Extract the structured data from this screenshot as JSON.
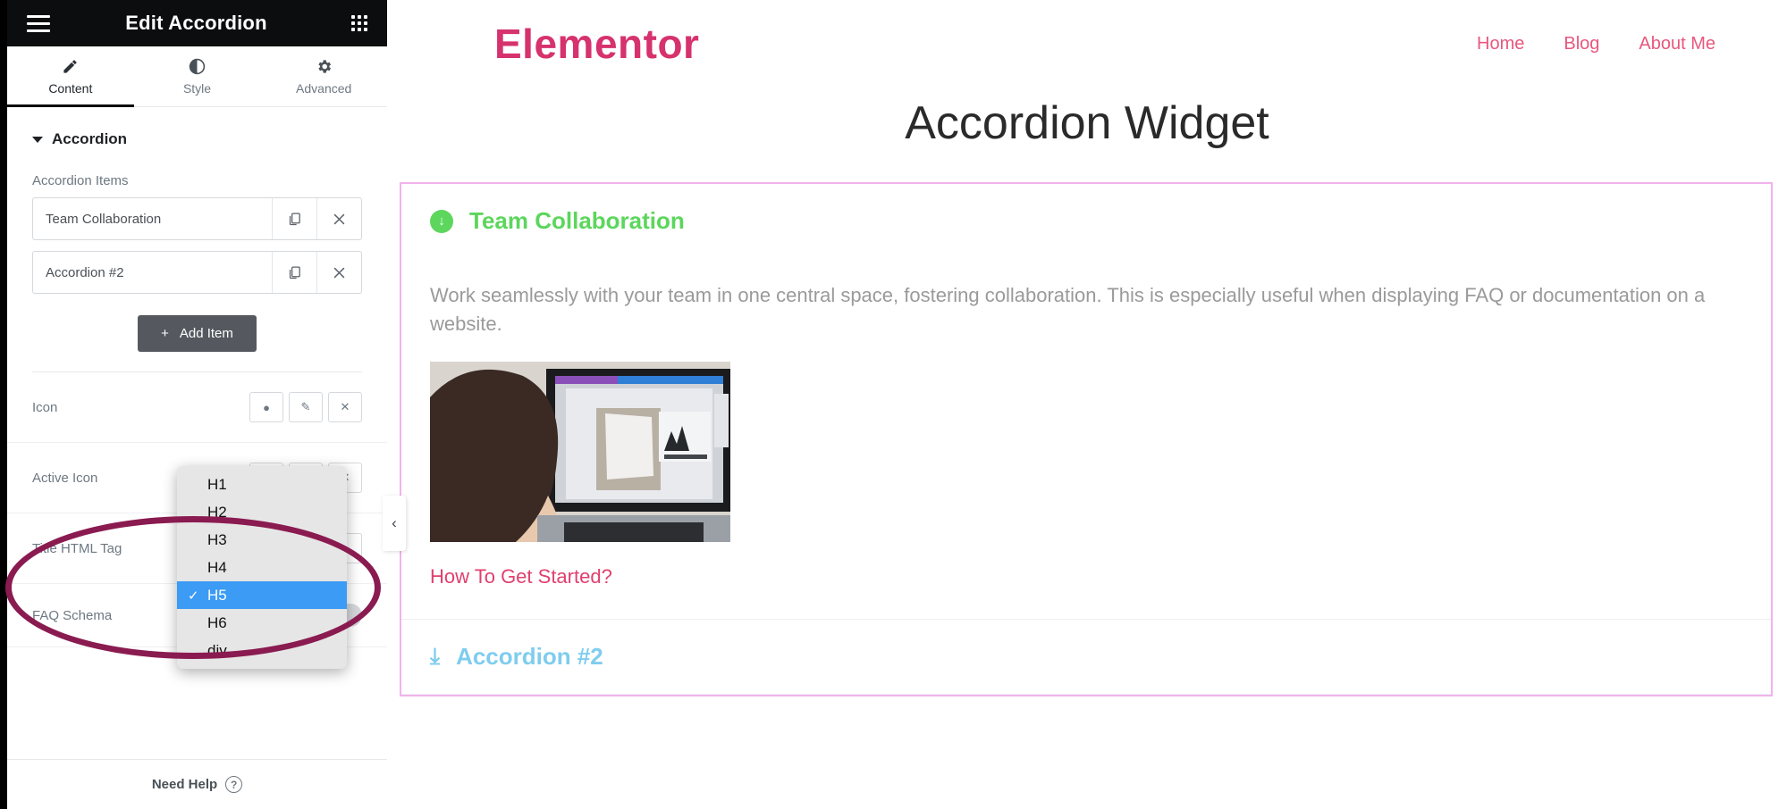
{
  "panel": {
    "title": "Edit Accordion",
    "menu_icon": "hamburger-icon",
    "apps_icon": "grid-icon",
    "tabs": [
      {
        "label": "Content",
        "icon": "pencil-icon",
        "active": true
      },
      {
        "label": "Style",
        "icon": "contrast-icon",
        "active": false
      },
      {
        "label": "Advanced",
        "icon": "gear-icon",
        "active": false
      }
    ],
    "section": {
      "title": "Accordion"
    },
    "items_label": "Accordion Items",
    "items": [
      {
        "title": "Team Collaboration",
        "duplicate_icon": "copy-icon",
        "remove_icon": "close-icon"
      },
      {
        "title": "Accordion #2",
        "duplicate_icon": "copy-icon",
        "remove_icon": "close-icon"
      }
    ],
    "add_item_label": "Add Item",
    "add_item_plus": "+",
    "controls": [
      {
        "label": "Icon",
        "type": "icon-picker"
      },
      {
        "label": "Active Icon",
        "type": "icon-picker"
      },
      {
        "label": "Title HTML Tag",
        "type": "select",
        "value": "H5"
      },
      {
        "label": "FAQ Schema",
        "type": "switcher",
        "value": "off"
      }
    ],
    "dropdown": {
      "open": true,
      "selected": "H5",
      "check_glyph": "✓",
      "options": [
        "H1",
        "H2",
        "H3",
        "H4",
        "H5",
        "H6",
        "div"
      ]
    },
    "footer": {
      "label": "Need Help",
      "icon": "question-mark-icon"
    },
    "collapse_icon": "chevron-left-icon"
  },
  "preview": {
    "brand": "Elementor",
    "nav": [
      "Home",
      "Blog",
      "About Me"
    ],
    "page_title": "Accordion Widget",
    "accordion": [
      {
        "icon": "circle-arrow-down-icon",
        "title": "Team Collaboration",
        "state": "open",
        "body_text": "Work seamlessly with your team in one central space, fostering collaboration. This is especially useful when displaying FAQ or documentation on a website.",
        "image_alt": "person-at-laptop-photo",
        "link_text": "How To Get Started?"
      },
      {
        "icon": "double-chevron-down-icon",
        "title": "Accordion #2",
        "state": "closed"
      }
    ]
  },
  "colors": {
    "panel_header_bg": "#0c0d0e",
    "brand_pink": "#d6326d",
    "nav_pink": "#e8577e",
    "accent_green": "#5cd65c",
    "accent_blue": "#7fcdee",
    "link_pink": "#e0406f",
    "highlight_blue": "#3b9bf5",
    "annotation_maroon": "#8a1b50",
    "widget_outline": "#f0b3ec"
  }
}
